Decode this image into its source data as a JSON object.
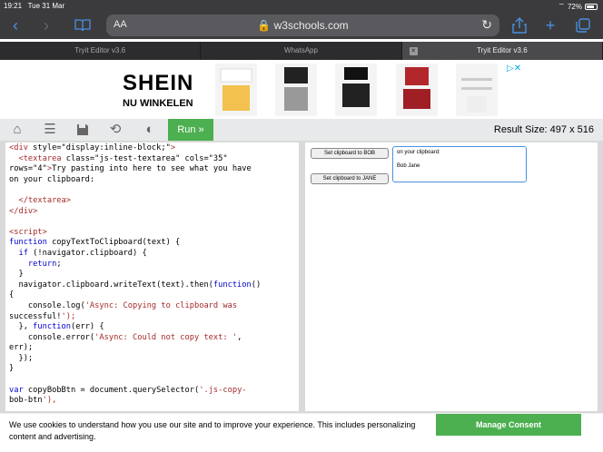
{
  "status": {
    "time": "19:21",
    "date": "Tue 31 Mar",
    "battery": "72%"
  },
  "browser": {
    "text_size_label": "AA",
    "url_host": "w3schools.com",
    "tabs": [
      {
        "label": "Tryit Editor v3.6",
        "active": false
      },
      {
        "label": "WhatsApp",
        "active": false
      },
      {
        "label": "Tryit Editor v3.6",
        "active": true
      }
    ]
  },
  "ad": {
    "brand": "SHEIN",
    "tagline": "NU WINKELEN"
  },
  "editor": {
    "run_label": "Run »",
    "result_size_label": "Result Size: 497 x 516"
  },
  "code_lines": [
    "<div style=\"display:inline-block;\">",
    "  <textarea class=\"js-test-textarea\" cols=\"35\"",
    "rows=\"4\">Try pasting into here to see what you have",
    "on your clipboard:",
    "",
    "  </textarea>",
    "</div>",
    "",
    "<script>",
    "function copyTextToClipboard(text) {",
    "  if (!navigator.clipboard) {",
    "    return;",
    "  }",
    "  navigator.clipboard.writeText(text).then(function()",
    "{",
    "    console.log('Async: Copying to clipboard was",
    "successful!');",
    "  }, function(err) {",
    "    console.error('Async: Could not copy text: ',",
    "err);",
    "  });",
    "}",
    "",
    "var copyBobBtn = document.querySelector('.js-copy-",
    "bob-btn'),"
  ],
  "result": {
    "btn_bob": "Set clipboard to BOB",
    "btn_jane": "Set clipboard to JANE",
    "textarea_line1": "on your clipboard:",
    "textarea_line2": "Bob Jane"
  },
  "cookie": {
    "text": "We use cookies to understand how you use our site and to improve your experience. This includes personalizing content and advertising.",
    "button": "Manage Consent"
  },
  "colors": {
    "run_green": "#4caf50",
    "safari_blue": "#4a90e2"
  }
}
